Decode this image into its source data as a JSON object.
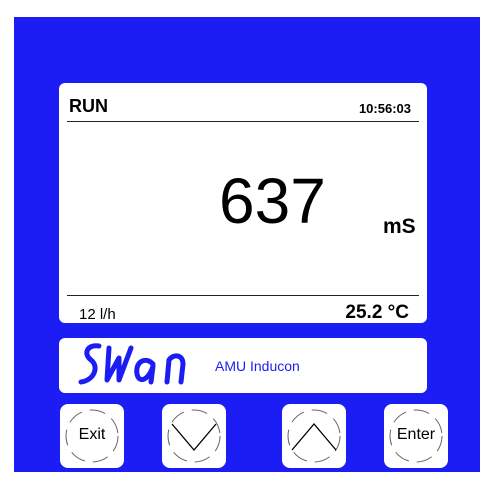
{
  "display": {
    "status": "RUN",
    "time": "10:56:03",
    "reading_value": "637",
    "reading_unit": "mS",
    "flow": "12 l/h",
    "temperature": "25.2 °C"
  },
  "brand": {
    "logo_text": "SWAN",
    "model": "AMU Inducon"
  },
  "keys": {
    "exit_label": "Exit",
    "enter_label": "Enter",
    "down_icon": "chevron-down-icon",
    "up_icon": "chevron-up-icon"
  },
  "colors": {
    "panel_blue": "#1c1cf5",
    "screen_white": "#ffffff",
    "text": "#000000"
  }
}
